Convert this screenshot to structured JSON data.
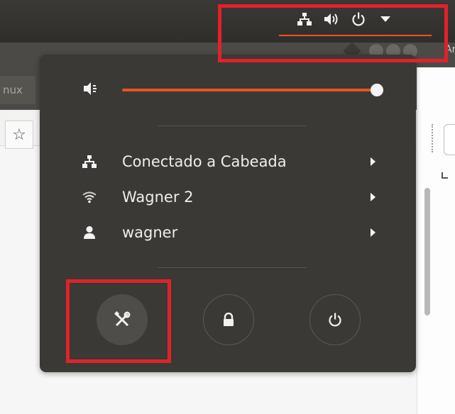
{
  "topbar": {
    "tray_icons": [
      "network-wired-icon",
      "speaker-icon",
      "power-icon",
      "dropdown-arrow-icon"
    ],
    "accent_color": "#e95420"
  },
  "browser": {
    "tab_fragment": "nux",
    "right_fragment": "Ar"
  },
  "system_menu": {
    "volume": {
      "icon": "speaker-icon",
      "level_percent": 100
    },
    "items": [
      {
        "icon": "network-wired-icon",
        "label": "Conectado a Cabeada"
      },
      {
        "icon": "wifi-icon",
        "label": "Wagner 2"
      },
      {
        "icon": "user-icon",
        "label": "wagner"
      }
    ],
    "buttons": [
      {
        "icon": "settings-tools-icon",
        "name": "settings"
      },
      {
        "icon": "lock-icon",
        "name": "lock"
      },
      {
        "icon": "power-icon",
        "name": "power-off"
      }
    ],
    "highlight_color": "#e2212b"
  }
}
